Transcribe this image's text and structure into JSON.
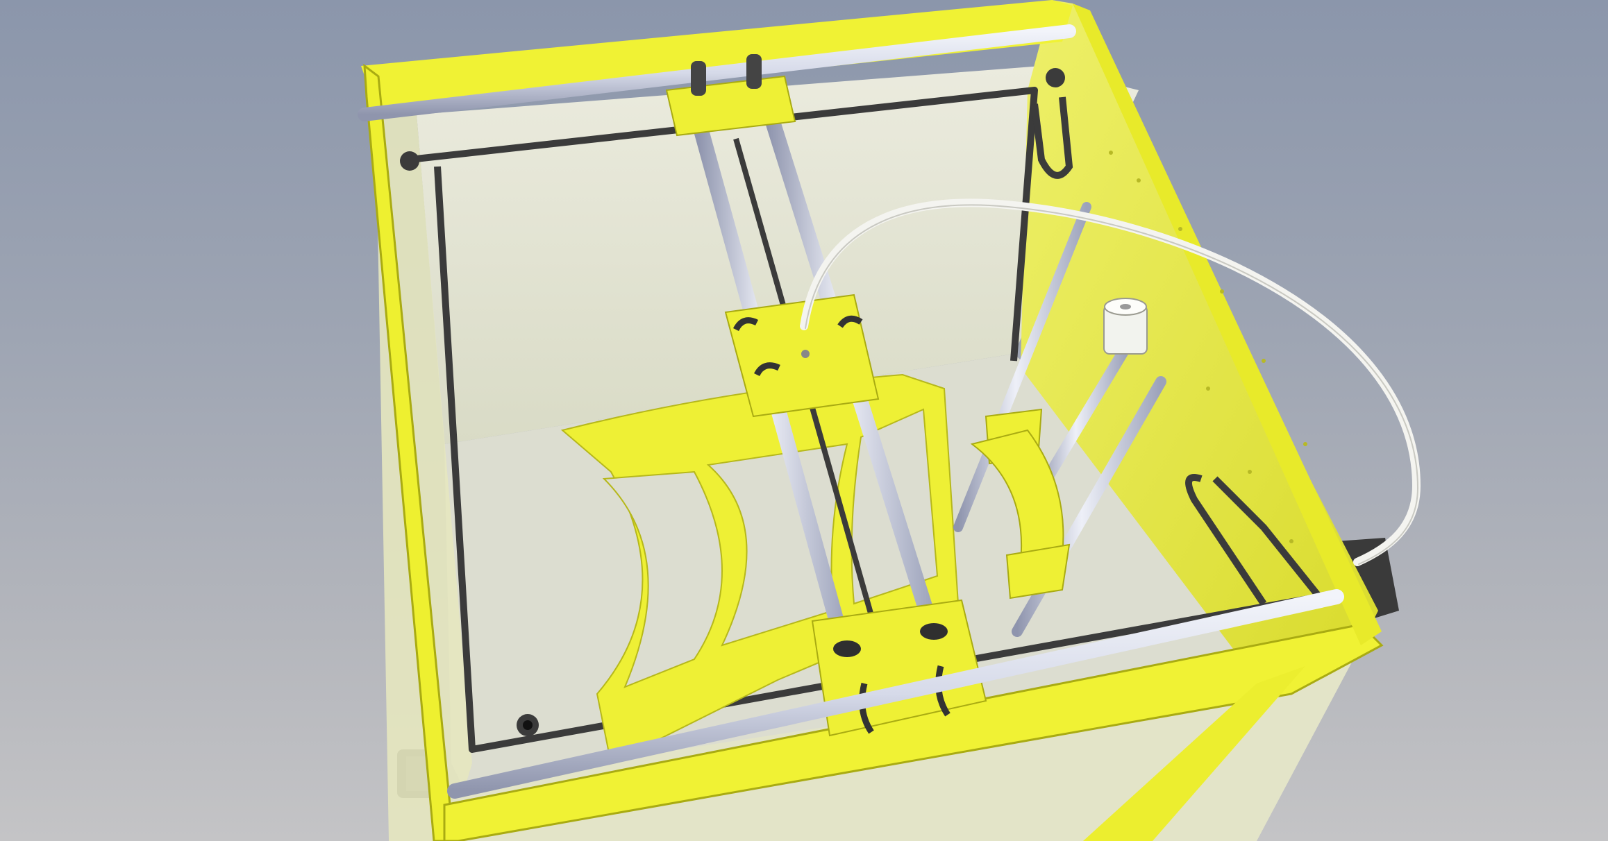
{
  "scene": {
    "subject": "3d-printer-frame-cad-render",
    "colors": {
      "background_top": "#8b96ab",
      "background_bottom": "#c4c4c6",
      "frame": "#f0f234",
      "frame_edge": "#a9ab12",
      "inner_wall": "#e5e6d2",
      "rod": "#cdd2e6",
      "rod_dark": "#8e94ad",
      "cable": "#f4f4f0",
      "dark_part": "#3b3b3b"
    }
  }
}
